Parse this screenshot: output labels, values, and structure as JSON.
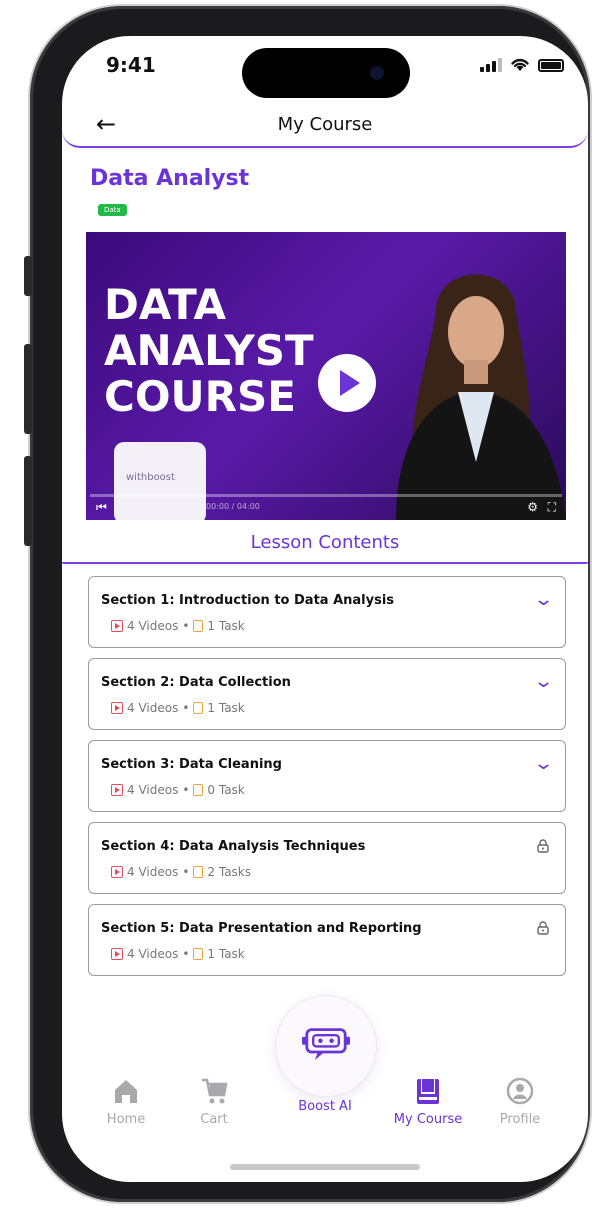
{
  "status_bar": {
    "time": "9:41"
  },
  "header": {
    "title": "My Course"
  },
  "course": {
    "title": "Data Analyst",
    "tag": "Data"
  },
  "video": {
    "overlay_lines": [
      "DATA",
      "ANALYST",
      "COURSE"
    ],
    "card_text": "withboost",
    "time": "00:00 / 04:00"
  },
  "lessons": {
    "title": "Lesson Contents",
    "sections": [
      {
        "title": "Section 1: Introduction to Data Analysis",
        "videos": "4 Videos",
        "sep": "•",
        "tasks": "1 Task",
        "state": "expandable"
      },
      {
        "title": "Section 2: Data Collection",
        "videos": "4 Videos",
        "sep": "•",
        "tasks": "1 Task",
        "state": "expandable"
      },
      {
        "title": "Section 3: Data Cleaning",
        "videos": "4 Videos",
        "sep": "•",
        "tasks": "0 Task",
        "state": "expandable"
      },
      {
        "title": "Section 4: Data Analysis Techniques",
        "videos": "4 Videos",
        "sep": "•",
        "tasks": "2 Tasks",
        "state": "locked"
      },
      {
        "title": "Section 5: Data Presentation and Reporting",
        "videos": "4 Videos",
        "sep": "•",
        "tasks": "1 Task",
        "state": "locked"
      }
    ]
  },
  "tabbar": {
    "home": "Home",
    "cart": "Cart",
    "boost": "Boost AI",
    "my_course": "My Course",
    "profile": "Profile",
    "active": "my_course"
  },
  "colors": {
    "accent": "#6b34d6",
    "tag_green": "#22b84a",
    "video_icon_red": "#e44b5a",
    "task_icon_orange": "#f2a23a",
    "inactive_gray": "#a8a8ad"
  }
}
